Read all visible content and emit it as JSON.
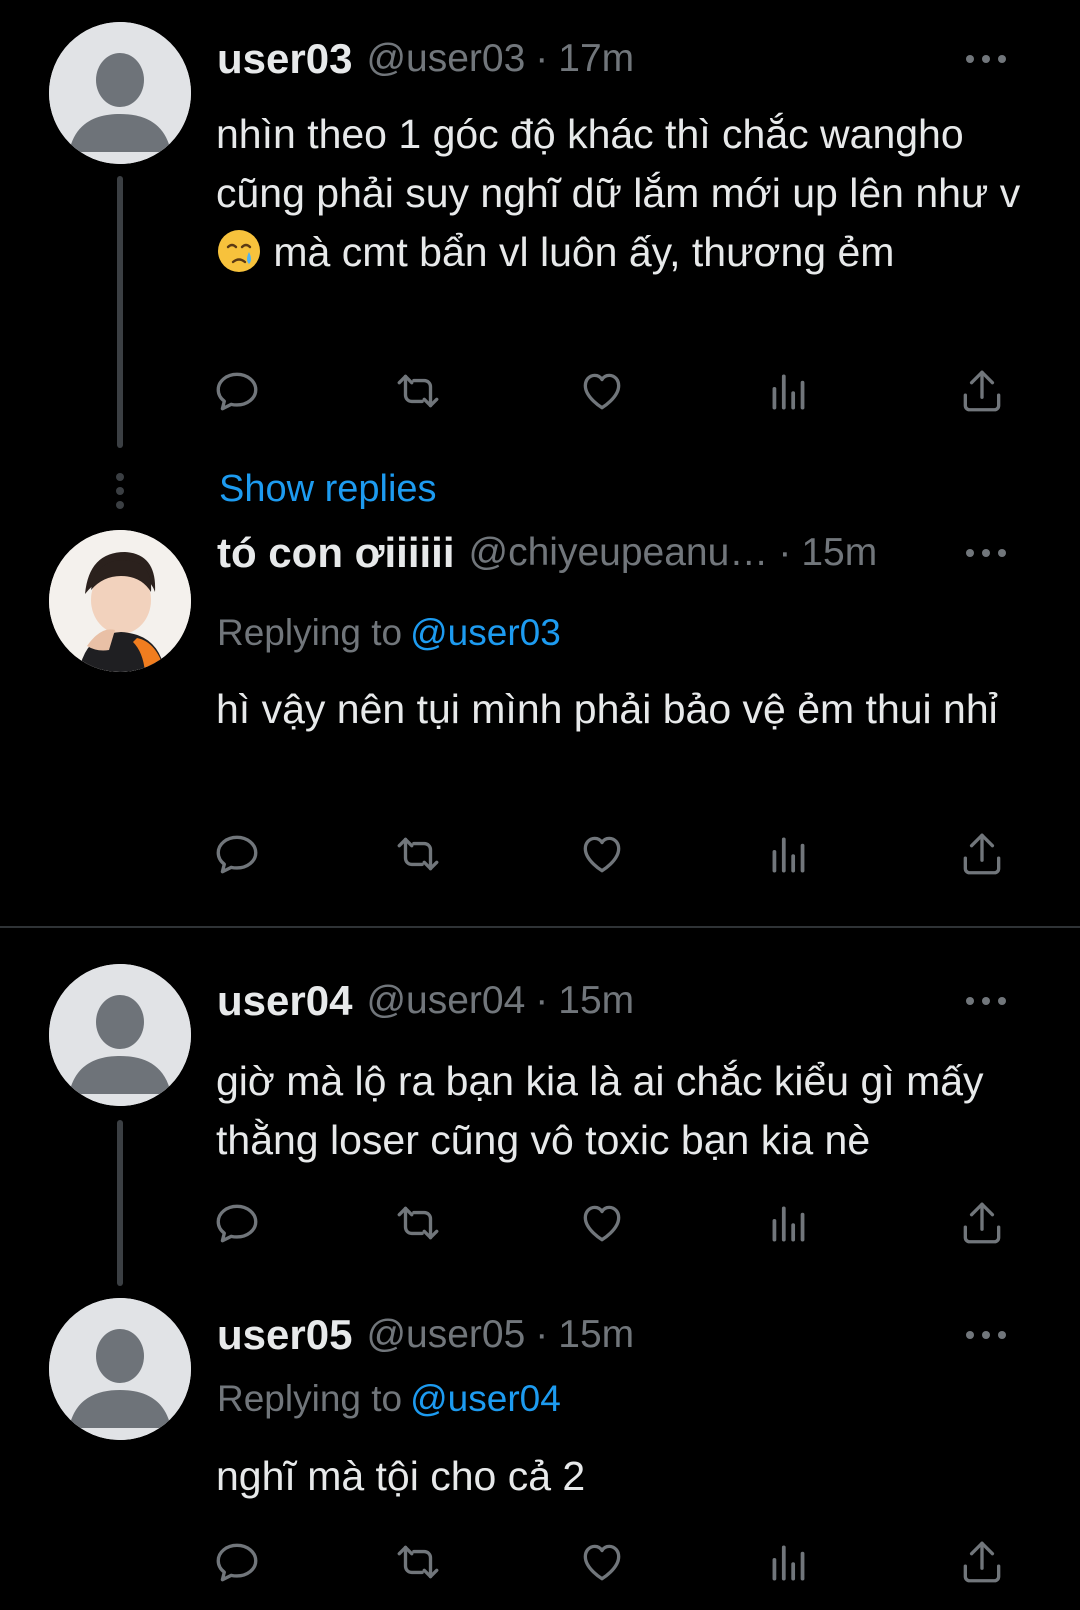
{
  "colors": {
    "background": "#000000",
    "text": "#e7e9ea",
    "muted": "#71767b",
    "accent": "#1d9bf0",
    "line": "#3b3f43"
  },
  "tweets": [
    {
      "name": "user03",
      "handle": "@user03",
      "sep": "·",
      "time": "17m",
      "avatar": "default-avatar",
      "text_before_emoji": "nhìn theo 1 góc độ khác thì chắc wangho cũng phải suy nghĩ dữ lắm mới up lên như v ",
      "emoji": "crying-face-emoji",
      "text_after_emoji": " mà cmt bẩn vl luôn ấy, thương ẻm"
    },
    {
      "name": "tó con ơiiiiii",
      "handle": "@chiyeupeanu…",
      "sep": "·",
      "time": "15m",
      "avatar": "profile-photo",
      "replying_label": "Replying to",
      "replying_to": "@user03",
      "text": "hì vậy nên tụi mình phải bảo vệ ẻm thui nhỉ"
    },
    {
      "name": "user04",
      "handle": "@user04",
      "sep": "·",
      "time": "15m",
      "avatar": "default-avatar",
      "text": "giờ mà lộ ra bạn kia là ai chắc kiểu gì mấy thằng loser cũng vô toxic bạn kia nè"
    },
    {
      "name": "user05",
      "handle": "@user05",
      "sep": "·",
      "time": "15m",
      "avatar": "default-avatar",
      "replying_label": "Replying to",
      "replying_to": "@user04",
      "text": "nghĩ mà tội cho cả 2"
    }
  ],
  "show_replies": "Show replies",
  "action_icons": [
    "reply-icon",
    "retweet-icon",
    "like-icon",
    "views-icon",
    "share-icon"
  ]
}
